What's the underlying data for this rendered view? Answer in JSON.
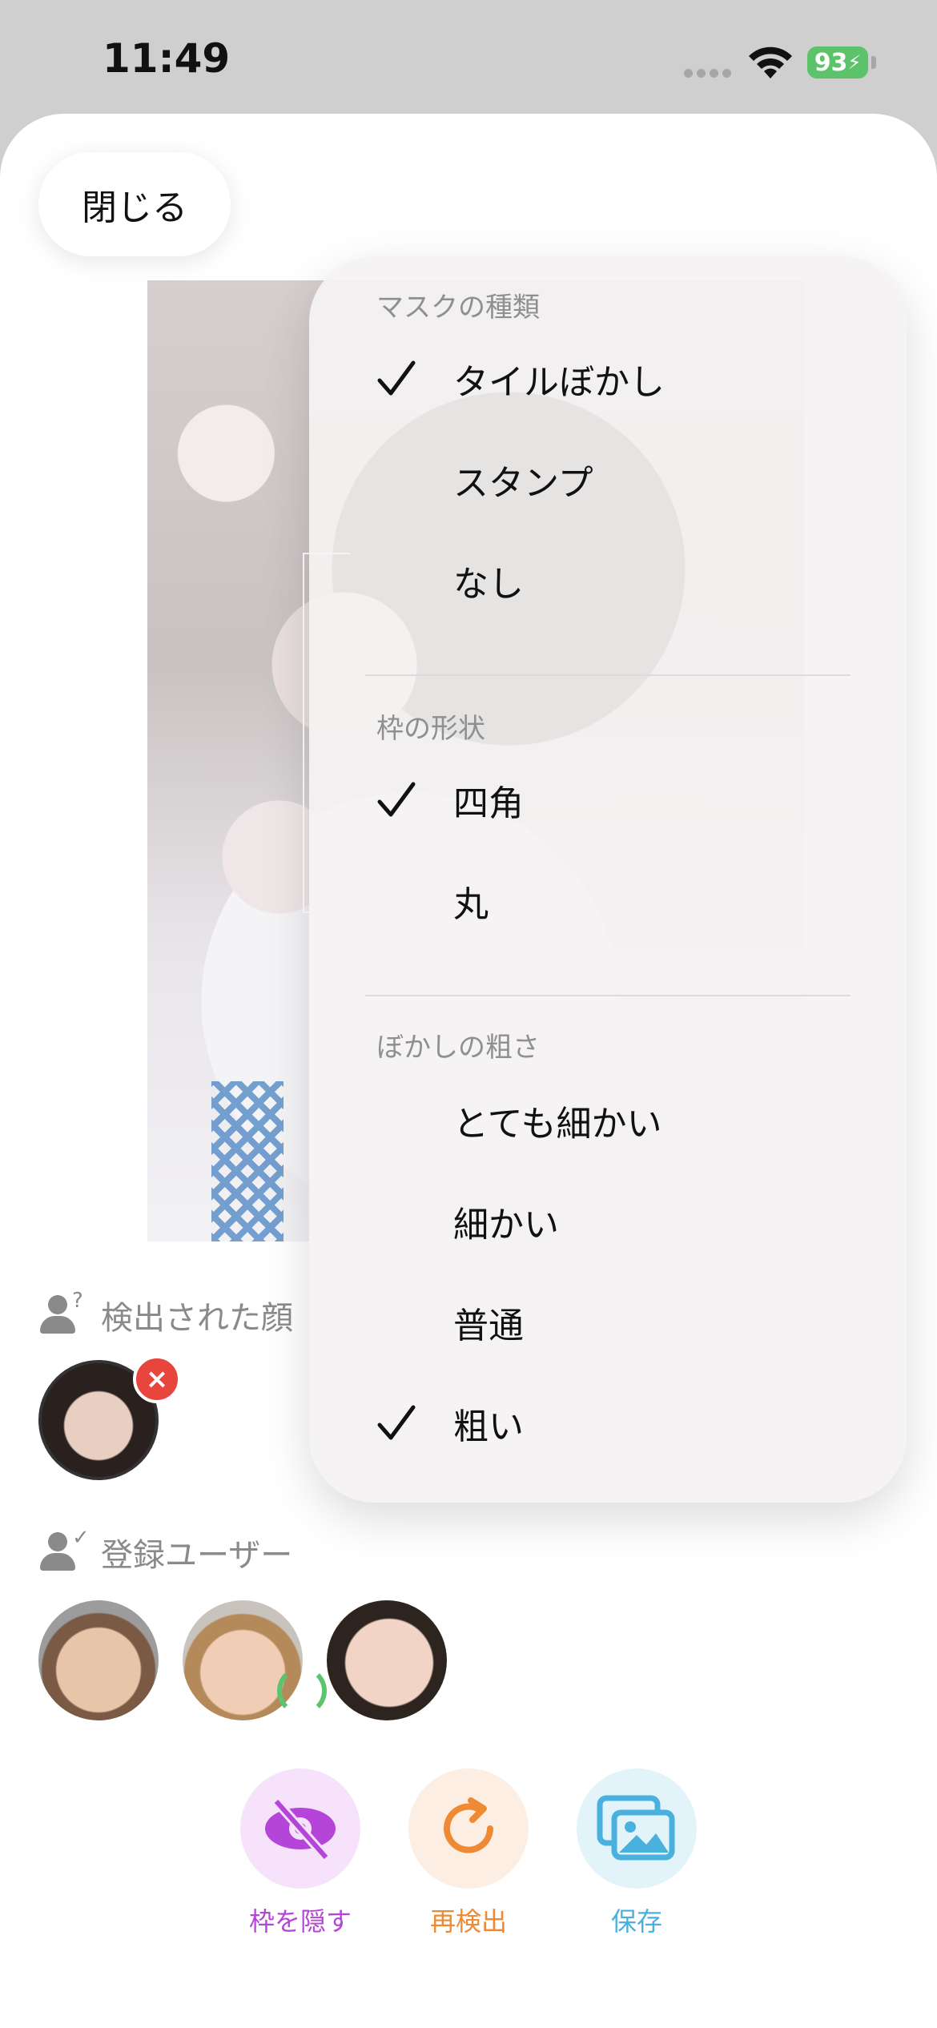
{
  "status_bar": {
    "time": "11:49",
    "battery": "93"
  },
  "close_button": "閉じる",
  "faces_section": {
    "label": "検出された顔"
  },
  "users_section": {
    "label": "登録ユーザー"
  },
  "actions": {
    "hide_frames": "枠を隠す",
    "redetect": "再検出",
    "save": "保存"
  },
  "menu": {
    "mask_title": "マスクの種類",
    "mask_items": [
      "タイルぼかし",
      "スタンプ",
      "なし"
    ],
    "shape_title": "枠の形状",
    "shape_items": [
      "四角",
      "丸"
    ],
    "coarse_title": "ぼかしの粗さ",
    "coarse_items": [
      "とても細かい",
      "細かい",
      "普通",
      "粗い"
    ]
  },
  "colors": {
    "hide": "#b544d8",
    "redetect": "#ef8a34",
    "save": "#4ab1df"
  }
}
